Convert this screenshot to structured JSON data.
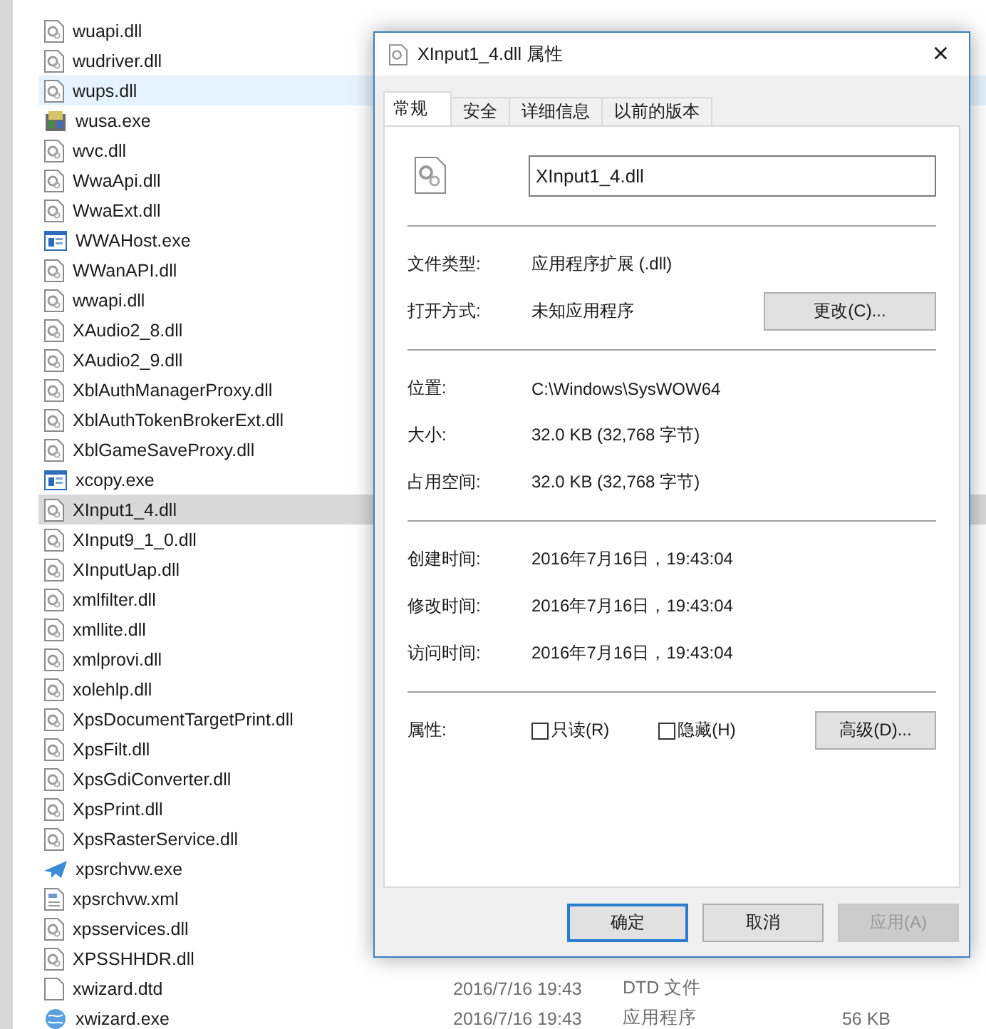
{
  "files": [
    {
      "name": "wuapi.dll",
      "kind": "dll",
      "selected": false,
      "hovered": false
    },
    {
      "name": "wudriver.dll",
      "kind": "dll",
      "selected": false,
      "hovered": false
    },
    {
      "name": "wups.dll",
      "kind": "dll",
      "selected": false,
      "hovered": true
    },
    {
      "name": "wusa.exe",
      "kind": "installer",
      "selected": false,
      "hovered": false
    },
    {
      "name": "wvc.dll",
      "kind": "dll",
      "selected": false,
      "hovered": false
    },
    {
      "name": "WwaApi.dll",
      "kind": "dll",
      "selected": false,
      "hovered": false
    },
    {
      "name": "WwaExt.dll",
      "kind": "dll",
      "selected": false,
      "hovered": false
    },
    {
      "name": "WWAHost.exe",
      "kind": "window",
      "selected": false,
      "hovered": false
    },
    {
      "name": "WWanAPI.dll",
      "kind": "dll",
      "selected": false,
      "hovered": false
    },
    {
      "name": "wwapi.dll",
      "kind": "dll",
      "selected": false,
      "hovered": false
    },
    {
      "name": "XAudio2_8.dll",
      "kind": "dll",
      "selected": false,
      "hovered": false
    },
    {
      "name": "XAudio2_9.dll",
      "kind": "dll",
      "selected": false,
      "hovered": false
    },
    {
      "name": "XblAuthManagerProxy.dll",
      "kind": "dll",
      "selected": false,
      "hovered": false
    },
    {
      "name": "XblAuthTokenBrokerExt.dll",
      "kind": "dll",
      "selected": false,
      "hovered": false
    },
    {
      "name": "XblGameSaveProxy.dll",
      "kind": "dll",
      "selected": false,
      "hovered": false
    },
    {
      "name": "xcopy.exe",
      "kind": "window",
      "selected": false,
      "hovered": false
    },
    {
      "name": "XInput1_4.dll",
      "kind": "dll",
      "selected": true,
      "hovered": false
    },
    {
      "name": "XInput9_1_0.dll",
      "kind": "dll",
      "selected": false,
      "hovered": false
    },
    {
      "name": "XInputUap.dll",
      "kind": "dll",
      "selected": false,
      "hovered": false
    },
    {
      "name": "xmlfilter.dll",
      "kind": "dll",
      "selected": false,
      "hovered": false
    },
    {
      "name": "xmllite.dll",
      "kind": "dll",
      "selected": false,
      "hovered": false
    },
    {
      "name": "xmlprovi.dll",
      "kind": "dll",
      "selected": false,
      "hovered": false
    },
    {
      "name": "xolehlp.dll",
      "kind": "dll",
      "selected": false,
      "hovered": false
    },
    {
      "name": "XpsDocumentTargetPrint.dll",
      "kind": "dll",
      "selected": false,
      "hovered": false
    },
    {
      "name": "XpsFilt.dll",
      "kind": "dll",
      "selected": false,
      "hovered": false
    },
    {
      "name": "XpsGdiConverter.dll",
      "kind": "dll",
      "selected": false,
      "hovered": false
    },
    {
      "name": "XpsPrint.dll",
      "kind": "dll",
      "selected": false,
      "hovered": false
    },
    {
      "name": "XpsRasterService.dll",
      "kind": "dll",
      "selected": false,
      "hovered": false
    },
    {
      "name": "xpsrchvw.exe",
      "kind": "viewer",
      "selected": false,
      "hovered": false
    },
    {
      "name": "xpsrchvw.xml",
      "kind": "xml",
      "selected": false,
      "hovered": false
    },
    {
      "name": "xpsservices.dll",
      "kind": "dll",
      "selected": false,
      "hovered": false
    },
    {
      "name": "XPSSHHDR.dll",
      "kind": "dll",
      "selected": false,
      "hovered": false
    },
    {
      "name": "xwizard.dtd",
      "kind": "blank",
      "selected": false,
      "hovered": false,
      "date": "2016/7/16 19:43",
      "type": "DTD 文件"
    },
    {
      "name": "xwizard.exe",
      "kind": "wizard",
      "selected": false,
      "hovered": false,
      "date": "2016/7/16 19:43",
      "type": "应用程序",
      "size": "56 KB"
    }
  ],
  "dialog": {
    "title": "XInput1_4.dll 属性",
    "close": "×",
    "tabs": [
      {
        "label": "常规",
        "selected": true
      },
      {
        "label": "安全",
        "selected": false
      },
      {
        "label": "详细信息",
        "selected": false
      },
      {
        "label": "以前的版本",
        "selected": false
      }
    ],
    "file_name": "XInput1_4.dll",
    "sections": [
      [
        {
          "label": "文件类型:",
          "value": "应用程序扩展 (.dll)"
        },
        {
          "label": "打开方式:",
          "value": "未知应用程序",
          "button": "更改(C)..."
        }
      ],
      [
        {
          "label": "位置:",
          "value": "C:\\Windows\\SysWOW64"
        },
        {
          "label": "大小:",
          "value": "32.0 KB (32,768 字节)"
        },
        {
          "label": "占用空间:",
          "value": "32.0 KB (32,768 字节)"
        }
      ],
      [
        {
          "label": "创建时间:",
          "value": "2016年7月16日，19:43:04"
        },
        {
          "label": "修改时间:",
          "value": "2016年7月16日，19:43:04"
        },
        {
          "label": "访问时间:",
          "value": "2016年7月16日，19:43:04"
        }
      ]
    ],
    "attributes": {
      "label": "属性:",
      "checkboxes": [
        {
          "label": "只读(R)",
          "checked": false
        },
        {
          "label": "隐藏(H)",
          "checked": false
        }
      ],
      "button": "高级(D)..."
    },
    "buttons": [
      {
        "label": "确定",
        "kind": "default",
        "disabled": false
      },
      {
        "label": "取消",
        "kind": "normal",
        "disabled": false
      },
      {
        "label": "应用(A)",
        "kind": "normal",
        "disabled": true
      }
    ]
  }
}
